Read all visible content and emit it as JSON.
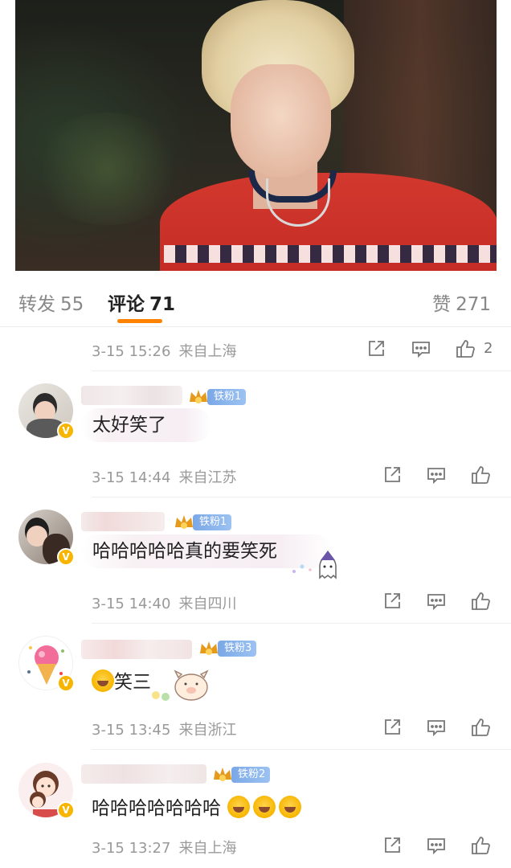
{
  "tabs": {
    "repost_label": "转发",
    "repost_count": "55",
    "comments_label": "评论",
    "comments_count": "71",
    "likes_label": "赞",
    "likes_count": "271",
    "accent_color": "#ff8200"
  },
  "top_comment_meta": {
    "date": "3-15 15:26",
    "location": "来自上海",
    "like_count": "2"
  },
  "comments": [
    {
      "fan_badge": "铁粉1",
      "text": "太好笑了",
      "date": "3-15 14:44",
      "location": "来自江苏",
      "verified_icon": "v-badge-icon"
    },
    {
      "fan_badge": "铁粉1",
      "text": "哈哈哈哈哈真的要笑死",
      "date": "3-15 14:40",
      "location": "来自四川",
      "verified_icon": "v-badge-icon"
    },
    {
      "fan_badge": "铁粉3",
      "text": "笑三",
      "date": "3-15 13:45",
      "location": "来自浙江",
      "verified_icon": "v-badge-icon"
    },
    {
      "fan_badge": "铁粉2",
      "text": "哈哈哈哈哈哈哈",
      "date": "3-15 13:27",
      "location": "来自上海",
      "verified_icon": "v-badge-icon"
    }
  ],
  "icons": {
    "share": "share-icon",
    "comment": "comment-icon",
    "like": "thumbs-up-icon",
    "laugh_emoji": "laughing-emoji-icon",
    "crown": "crown-icon"
  }
}
